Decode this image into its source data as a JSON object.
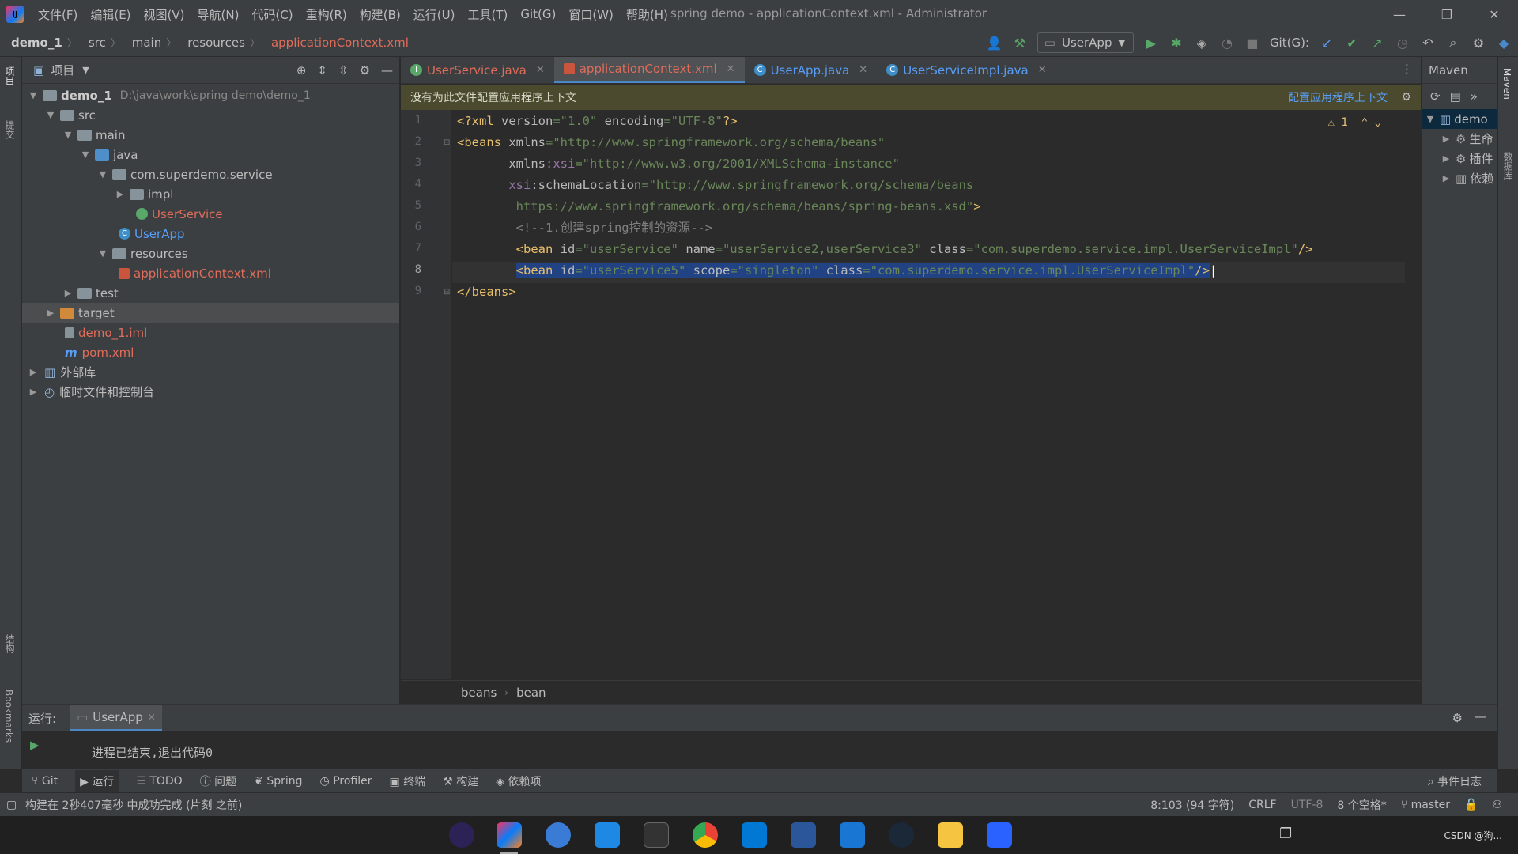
{
  "menu": [
    "文件(F)",
    "编辑(E)",
    "视图(V)",
    "导航(N)",
    "代码(C)",
    "重构(R)",
    "构建(B)",
    "运行(U)",
    "工具(T)",
    "Git(G)",
    "窗口(W)",
    "帮助(H)"
  ],
  "window_title": "spring demo - applicationContext.xml - Administrator",
  "breadcrumb": [
    "demo_1",
    "src",
    "main",
    "resources",
    "applicationContext.xml"
  ],
  "run_config": "UserApp",
  "git_label": "Git(G):",
  "project_panel": {
    "title": "项目",
    "tree": [
      {
        "label": "demo_1",
        "path": "D:\\java\\work\\spring demo\\demo_1"
      },
      {
        "label": "src"
      },
      {
        "label": "main"
      },
      {
        "label": "java"
      },
      {
        "label": "com.superdemo.service"
      },
      {
        "label": "impl"
      },
      {
        "label": "UserService"
      },
      {
        "label": "UserApp"
      },
      {
        "label": "resources"
      },
      {
        "label": "applicationContext.xml"
      },
      {
        "label": "test"
      },
      {
        "label": "target"
      },
      {
        "label": "demo_1.iml"
      },
      {
        "label": "pom.xml"
      },
      {
        "label": "外部库"
      },
      {
        "label": "临时文件和控制台"
      }
    ]
  },
  "editor_tabs": [
    "UserService.java",
    "applicationContext.xml",
    "UserApp.java",
    "UserServiceImpl.java"
  ],
  "banner": {
    "text": "没有为此文件配置应用程序上下文",
    "link": "配置应用程序上下文"
  },
  "warning_count": "1",
  "line_numbers": [
    "1",
    "2",
    "3",
    "4",
    "5",
    "6",
    "7",
    "8",
    "9"
  ],
  "editor_breadcrumb": [
    "beans",
    "bean"
  ],
  "maven": {
    "title": "Maven",
    "root": "demo",
    "items": [
      "生命",
      "插件",
      "依赖"
    ]
  },
  "left_strip": [
    "项目",
    "提交",
    "结构",
    "Bookmarks"
  ],
  "right_strip": [
    "Maven",
    "数据库"
  ],
  "run_panel": {
    "label": "运行:",
    "tab": "UserApp",
    "output": "进程已结束,退出代码0"
  },
  "tool_tabs": [
    "Git",
    "运行",
    "TODO",
    "问题",
    "Spring",
    "Profiler",
    "终端",
    "构建",
    "依赖项"
  ],
  "event_log": "事件日志",
  "status": {
    "left": "构建在 2秒407毫秒 中成功完成 (片刻 之前)",
    "position": "8:103 (94 字符)",
    "line_sep": "CRLF",
    "encoding": "UTF-8",
    "indent": "8 个空格*",
    "branch": "master"
  },
  "taskbar_watermark": "CSDN @狗..."
}
